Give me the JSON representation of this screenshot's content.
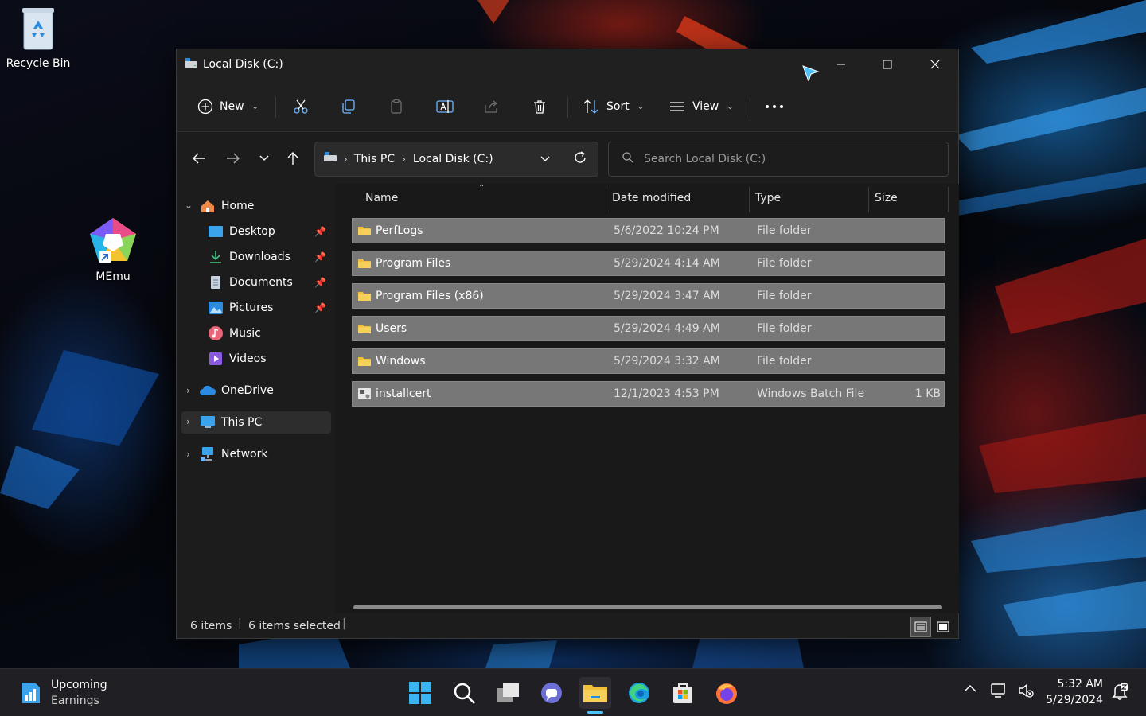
{
  "desktop": {
    "icons": [
      {
        "label": "Recycle Bin"
      },
      {
        "label": "MEmu"
      }
    ]
  },
  "window": {
    "title": "Local Disk (C:)",
    "toolbar": {
      "new_label": "New",
      "sort_label": "Sort",
      "view_label": "View"
    },
    "address": {
      "crumbs": [
        "This PC",
        "Local Disk (C:)"
      ]
    },
    "search": {
      "placeholder": "Search Local Disk (C:)"
    },
    "sidebar": {
      "items": [
        {
          "label": "Home"
        },
        {
          "label": "Desktop"
        },
        {
          "label": "Downloads"
        },
        {
          "label": "Documents"
        },
        {
          "label": "Pictures"
        },
        {
          "label": "Music"
        },
        {
          "label": "Videos"
        },
        {
          "label": "OneDrive"
        },
        {
          "label": "This PC"
        },
        {
          "label": "Network"
        }
      ]
    },
    "columns": [
      "Name",
      "Date modified",
      "Type",
      "Size"
    ],
    "files": [
      {
        "name": "PerfLogs",
        "date": "5/6/2022 10:24 PM",
        "type": "File folder",
        "size": "",
        "icon": "folder-icon"
      },
      {
        "name": "Program Files",
        "date": "5/29/2024 4:14 AM",
        "type": "File folder",
        "size": "",
        "icon": "folder-icon"
      },
      {
        "name": "Program Files (x86)",
        "date": "5/29/2024 3:47 AM",
        "type": "File folder",
        "size": "",
        "icon": "folder-icon"
      },
      {
        "name": "Users",
        "date": "5/29/2024 4:49 AM",
        "type": "File folder",
        "size": "",
        "icon": "folder-icon"
      },
      {
        "name": "Windows",
        "date": "5/29/2024 3:32 AM",
        "type": "File folder",
        "size": "",
        "icon": "folder-icon"
      },
      {
        "name": "installcert",
        "date": "12/1/2023 4:53 PM",
        "type": "Windows Batch File",
        "size": "1 KB",
        "icon": "batch-file-icon"
      }
    ],
    "status": {
      "items": "6 items",
      "selected": "6 items selected"
    }
  },
  "taskbar": {
    "widget": {
      "line1": "Upcoming",
      "line2": "Earnings"
    },
    "clock": {
      "time": "5:32 AM",
      "date": "5/29/2024"
    }
  },
  "colors": {
    "window_bg": "#1c1c1c",
    "row_selected": "#777777",
    "folder": "#f2c03a",
    "accent": "#4cc2ff"
  }
}
